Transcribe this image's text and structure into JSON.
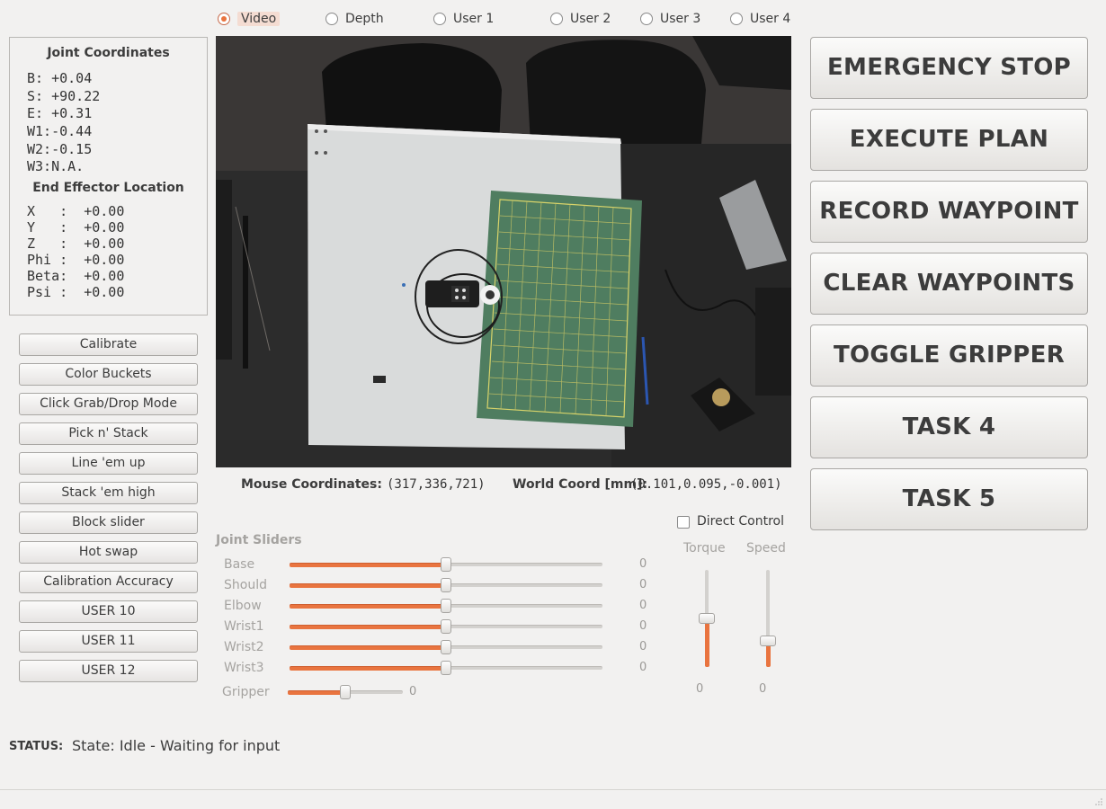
{
  "view_modes": [
    {
      "label": "Video",
      "checked": true
    },
    {
      "label": "Depth",
      "checked": false
    },
    {
      "label": "User 1",
      "checked": false
    },
    {
      "label": "User 2",
      "checked": false
    },
    {
      "label": "User 3",
      "checked": false
    },
    {
      "label": "User 4",
      "checked": false
    }
  ],
  "joint_coordinates": {
    "title": "Joint Coordinates",
    "rows": [
      {
        "label": "B:",
        "value": "+0.04"
      },
      {
        "label": "S:",
        "value": "+90.22"
      },
      {
        "label": "E:",
        "value": "+0.31"
      },
      {
        "label": "W1:",
        "value": "-0.44"
      },
      {
        "label": "W2:",
        "value": "-0.15"
      },
      {
        "label": "W3:",
        "value": "N.A."
      }
    ]
  },
  "end_effector": {
    "title": "End Effector Location",
    "rows": [
      {
        "label": "X   :",
        "value": "+0.00"
      },
      {
        "label": "Y   :",
        "value": "+0.00"
      },
      {
        "label": "Z   :",
        "value": "+0.00"
      },
      {
        "label": "Phi :",
        "value": "+0.00"
      },
      {
        "label": "Beta:",
        "value": "+0.00"
      },
      {
        "label": "Psi :",
        "value": "+0.00"
      }
    ]
  },
  "left_buttons": [
    "Calibrate",
    "Color Buckets",
    "Click Grab/Drop Mode",
    "Pick n' Stack",
    "Line 'em up",
    "Stack 'em high",
    "Block slider",
    "Hot swap",
    "Calibration Accuracy",
    "USER 10",
    "USER 11",
    "USER 12"
  ],
  "coordinates": {
    "mouse_label": "Mouse Coordinates:",
    "mouse_value": "(317,336,721)",
    "world_label": "World Coord [mm]:",
    "world_value": "(0.101,0.095,-0.001)"
  },
  "sliders": {
    "title": "Joint Sliders",
    "joints": [
      {
        "label": "Base",
        "value": "0",
        "fraction": 0.5
      },
      {
        "label": "Shoulder",
        "value": "0",
        "fraction": 0.5
      },
      {
        "label": "Elbow",
        "value": "0",
        "fraction": 0.5
      },
      {
        "label": "Wrist1",
        "value": "0",
        "fraction": 0.5
      },
      {
        "label": "Wrist2",
        "value": "0",
        "fraction": 0.5
      },
      {
        "label": "Wrist3",
        "value": "0",
        "fraction": 0.5
      }
    ],
    "gripper": {
      "label": "Gripper",
      "value": "0",
      "fraction": 0.5
    }
  },
  "direct_control": {
    "label": "Direct Control",
    "checked": false
  },
  "torque": {
    "label": "Torque",
    "value": "0",
    "fraction": 0.5
  },
  "speed": {
    "label": "Speed",
    "value": "0",
    "fraction": 0.27
  },
  "big_buttons": [
    "EMERGENCY STOP",
    "EXECUTE PLAN",
    "RECORD WAYPOINT",
    "CLEAR WAYPOINTS",
    "TOGGLE GRIPPER",
    "TASK 4",
    "TASK 5"
  ],
  "status": {
    "label": "STATUS:",
    "text": "State: Idle - Waiting for input"
  },
  "colors": {
    "accent": "#e9743f",
    "window_bg": "#f2f1f0",
    "cutting_mat": "#4f7d60"
  }
}
